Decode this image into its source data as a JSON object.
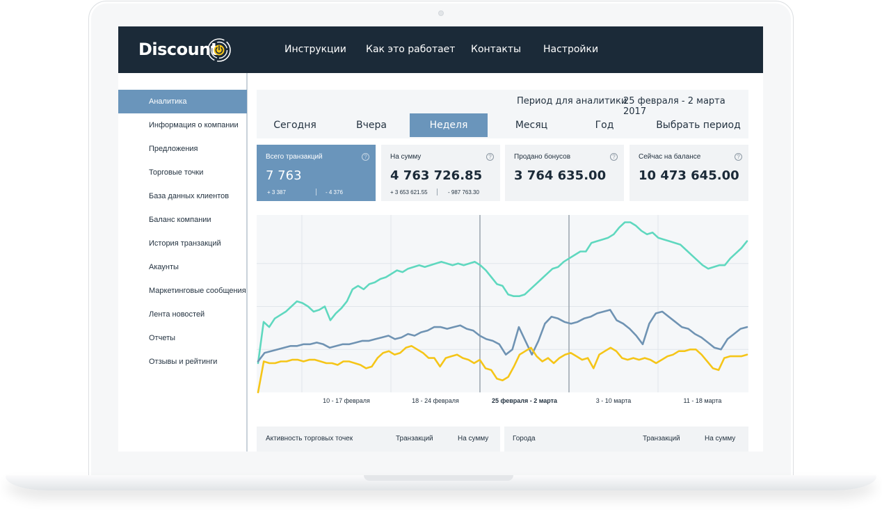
{
  "app": {
    "logo_text": "Discount"
  },
  "nav": [
    "Инструкции",
    "Как это работает",
    "Контакты",
    "Настройки"
  ],
  "sidebar": {
    "active_index": 0,
    "items": [
      "Аналитика",
      "Информация о компании",
      "Предложения",
      "Торговые точки",
      "База данных клиентов",
      "Баланс компании",
      "История транзакций",
      "Акаунты",
      "Маркетинговые сообщения",
      "Лента новостей",
      "Отчеты",
      "Отзывы и рейтинги"
    ]
  },
  "period": {
    "label": "Период для аналитики",
    "value": "25 февраля - 2 марта 2017",
    "tabs": [
      "Сегодня",
      "Вчера",
      "Неделя",
      "Месяц",
      "Год",
      "Выбрать период"
    ],
    "active_tab": "Неделя"
  },
  "stats": [
    {
      "label": "Всего транзакций",
      "value": "7 763",
      "plus": "+ 3 387",
      "minus": "- 4 376"
    },
    {
      "label": "На сумму",
      "value": "4 763 726.85",
      "plus": "+ 3 653 621.55",
      "minus": "- 987 763.30"
    },
    {
      "label": "Продано бонусов",
      "value": "3 764 635.00"
    },
    {
      "label": "Сейчас на балансе",
      "value": "10 473 645.00"
    }
  ],
  "colors": {
    "topbar": "#1b2a38",
    "accent": "#6a95bb",
    "series_teal": "#5fd8bf",
    "series_blue": "#6f93b3",
    "series_yellow": "#f5c518"
  },
  "chart_data": {
    "type": "line",
    "x_tick_labels": [
      "10 - 17 февраля",
      "18 - 24 февраля",
      "25 февраля - 2 марта",
      "3 - 10 марта",
      "11 - 18 марта"
    ],
    "highlighted_tick": "25 февраля - 2 марта",
    "grid": true,
    "series": [
      {
        "color": "#5fd8bf",
        "values": [
          0.17,
          0.41,
          0.38,
          0.43,
          0.45,
          0.47,
          0.5,
          0.53,
          0.52,
          0.5,
          0.47,
          0.48,
          0.5,
          0.42,
          0.46,
          0.49,
          0.53,
          0.6,
          0.62,
          0.6,
          0.63,
          0.64,
          0.66,
          0.67,
          0.69,
          0.71,
          0.7,
          0.72,
          0.73,
          0.74,
          0.73,
          0.74,
          0.75,
          0.76,
          0.75,
          0.74,
          0.75,
          0.74,
          0.75,
          0.76,
          0.74,
          0.71,
          0.67,
          0.63,
          0.62,
          0.57,
          0.56,
          0.56,
          0.57,
          0.6,
          0.63,
          0.66,
          0.69,
          0.72,
          0.73,
          0.76,
          0.78,
          0.8,
          0.82,
          0.82,
          0.87,
          0.88,
          0.89,
          0.9,
          0.92,
          0.96,
          0.99,
          0.99,
          0.97,
          0.94,
          0.92,
          0.93,
          0.9,
          0.89,
          0.88,
          0.87,
          0.86,
          0.83,
          0.8,
          0.77,
          0.74,
          0.72,
          0.73,
          0.74,
          0.74,
          0.78,
          0.81,
          0.84,
          0.88
        ]
      },
      {
        "color": "#6f93b3",
        "values": [
          0.18,
          0.23,
          0.24,
          0.25,
          0.26,
          0.27,
          0.27,
          0.28,
          0.28,
          0.29,
          0.28,
          0.26,
          0.27,
          0.28,
          0.28,
          0.29,
          0.3,
          0.3,
          0.31,
          0.32,
          0.33,
          0.31,
          0.32,
          0.34,
          0.33,
          0.35,
          0.36,
          0.38,
          0.38,
          0.37,
          0.38,
          0.39,
          0.37,
          0.36,
          0.33,
          0.31,
          0.3,
          0.28,
          0.22,
          0.25,
          0.38,
          0.3,
          0.22,
          0.3,
          0.4,
          0.44,
          0.43,
          0.41,
          0.4,
          0.41,
          0.43,
          0.44,
          0.46,
          0.47,
          0.48,
          0.42,
          0.4,
          0.37,
          0.33,
          0.28,
          0.4,
          0.46,
          0.47,
          0.44,
          0.41,
          0.38,
          0.37,
          0.34,
          0.32,
          0.29,
          0.26,
          0.25,
          0.31,
          0.34,
          0.37,
          0.38
        ]
      },
      {
        "color": "#f5c518",
        "values": [
          0.0,
          0.18,
          0.17,
          0.17,
          0.18,
          0.18,
          0.19,
          0.19,
          0.18,
          0.19,
          0.19,
          0.18,
          0.17,
          0.17,
          0.16,
          0.18,
          0.18,
          0.17,
          0.16,
          0.14,
          0.15,
          0.2,
          0.23,
          0.24,
          0.22,
          0.23,
          0.26,
          0.27,
          0.25,
          0.23,
          0.2,
          0.2,
          0.15,
          0.2,
          0.21,
          0.22,
          0.2,
          0.19,
          0.17,
          0.19,
          0.14,
          0.13,
          0.08,
          0.07,
          0.09,
          0.15,
          0.22,
          0.24,
          0.26,
          0.21,
          0.18,
          0.2,
          0.17,
          0.2,
          0.22,
          0.23,
          0.21,
          0.19,
          0.2,
          0.14,
          0.22,
          0.24,
          0.26,
          0.24,
          0.2,
          0.19,
          0.2,
          0.19,
          0.2,
          0.19,
          0.17,
          0.19,
          0.21,
          0.22,
          0.24,
          0.24,
          0.25,
          0.25,
          0.22,
          0.18,
          0.14,
          0.13,
          0.2,
          0.21,
          0.21,
          0.21,
          0.22
        ]
      }
    ]
  },
  "tables": [
    {
      "title": "Активность торговых точек",
      "col1": "Транзакций",
      "col2": "На сумму"
    },
    {
      "title": "Города",
      "col1": "Транзакций",
      "col2": "На сумму"
    }
  ]
}
